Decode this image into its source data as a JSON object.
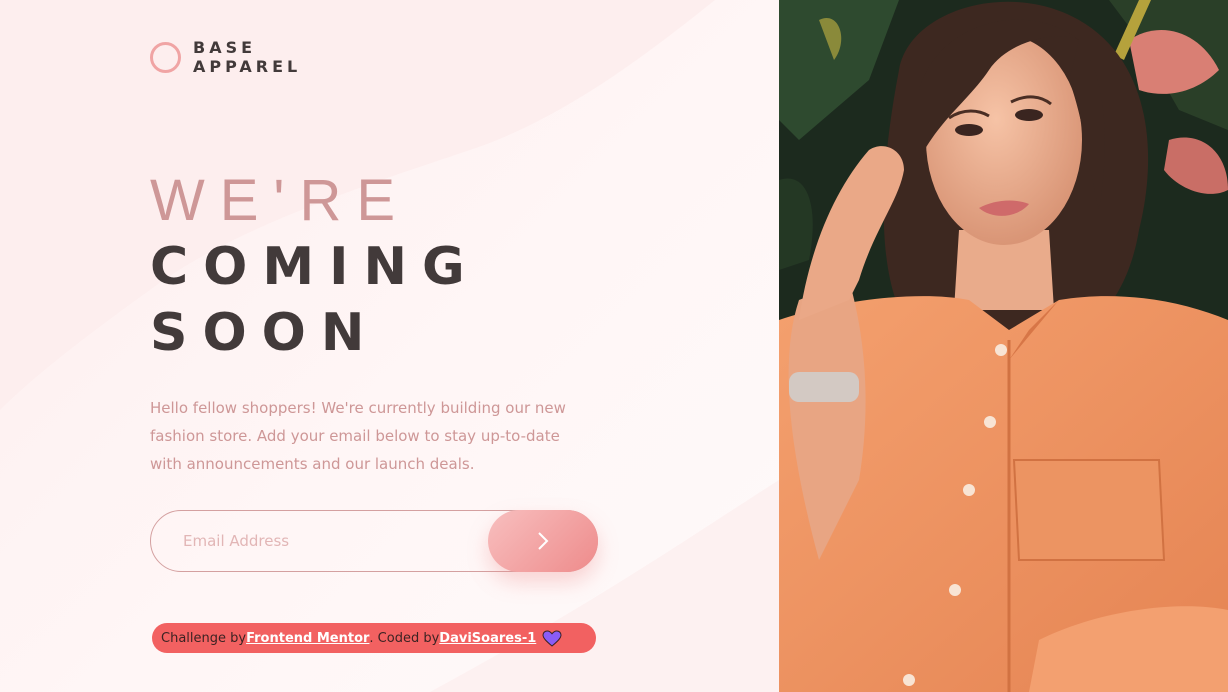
{
  "brand": {
    "line1": "BASE",
    "line2": "APPAREL"
  },
  "headline": {
    "line1": "WE'RE",
    "line2": "COMING",
    "line3": "SOON"
  },
  "description": "Hello fellow shoppers! We're currently building our new fashion store. Add your email below to stay up-to-date with announcements and our launch deals.",
  "form": {
    "email_placeholder": "Email Address",
    "email_value": ""
  },
  "attribution": {
    "prefix": "Challenge by ",
    "mentor_link": "Frontend Mentor",
    "middle": ". Coded by ",
    "author_link": "DaviSoares-1"
  },
  "colors": {
    "accent": "#ce9797",
    "dark": "#423a3a",
    "button_start": "#f8bfbf",
    "button_end": "#ee8b8b",
    "attribution_bg": "#f26161",
    "heart": "#8a5cf6"
  },
  "icons": {
    "logo": "ring-logo-icon",
    "submit": "chevron-right-icon",
    "heart": "heart-icon"
  }
}
